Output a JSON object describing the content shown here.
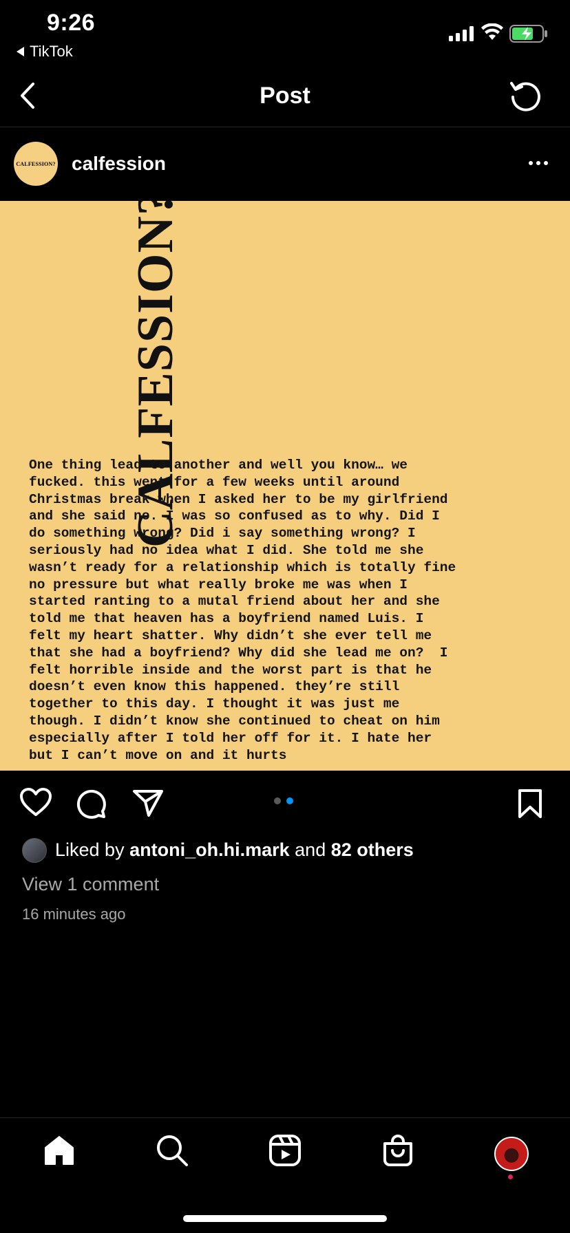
{
  "status_bar": {
    "time": "9:26",
    "back_app": "TikTok",
    "battery_color": "#4cd964"
  },
  "header": {
    "title": "Post",
    "back_icon": "chevron-left-icon",
    "refresh_icon": "refresh-icon"
  },
  "post": {
    "username": "calfession",
    "avatar_text": "CALFESSION?",
    "image": {
      "background": "#f5cf7e",
      "brand_text": "CALFESSION?",
      "confession_text": "One thing lead to another and well you know… we\nfucked. this went for a few weeks until around\nChristmas break when I asked her to be my girlfriend\nand she said no. I was so confused as to why. Did I\ndo something wrong? Did i say something wrong? I\nseriously had no idea what I did. She told me she\nwasn’t ready for a relationship which is totally fine\nno pressure but what really broke me was when I\nstarted ranting to a mutal friend about her and she\ntold me that heaven has a boyfriend named Luis. I\nfelt my heart shatter. Why didn’t she ever tell me\nthat she had a boyfriend? Why did she lead me on?  I\nfelt horrible inside and the worst part is that he\ndoesn’t even know this happened. they’re still\ntogether to this day. I thought it was just me\nthough. I didn’t know she continued to cheat on him\nespecially after I told her off for it. I hate her\nbut I can’t move on and it hurts"
    },
    "carousel": {
      "count": 2,
      "active_index": 1,
      "active_color": "#0095f6",
      "inactive_color": "#5a5a5a"
    },
    "likes": {
      "prefix": "Liked by",
      "user": "antoni_oh.hi.mark",
      "joiner": "and",
      "others": "82 others"
    },
    "view_comments": "View 1 comment",
    "timestamp": "16 minutes ago"
  },
  "tab_bar": {
    "items": [
      "home-icon",
      "search-icon",
      "reels-icon",
      "shop-icon",
      "profile-avatar"
    ]
  }
}
